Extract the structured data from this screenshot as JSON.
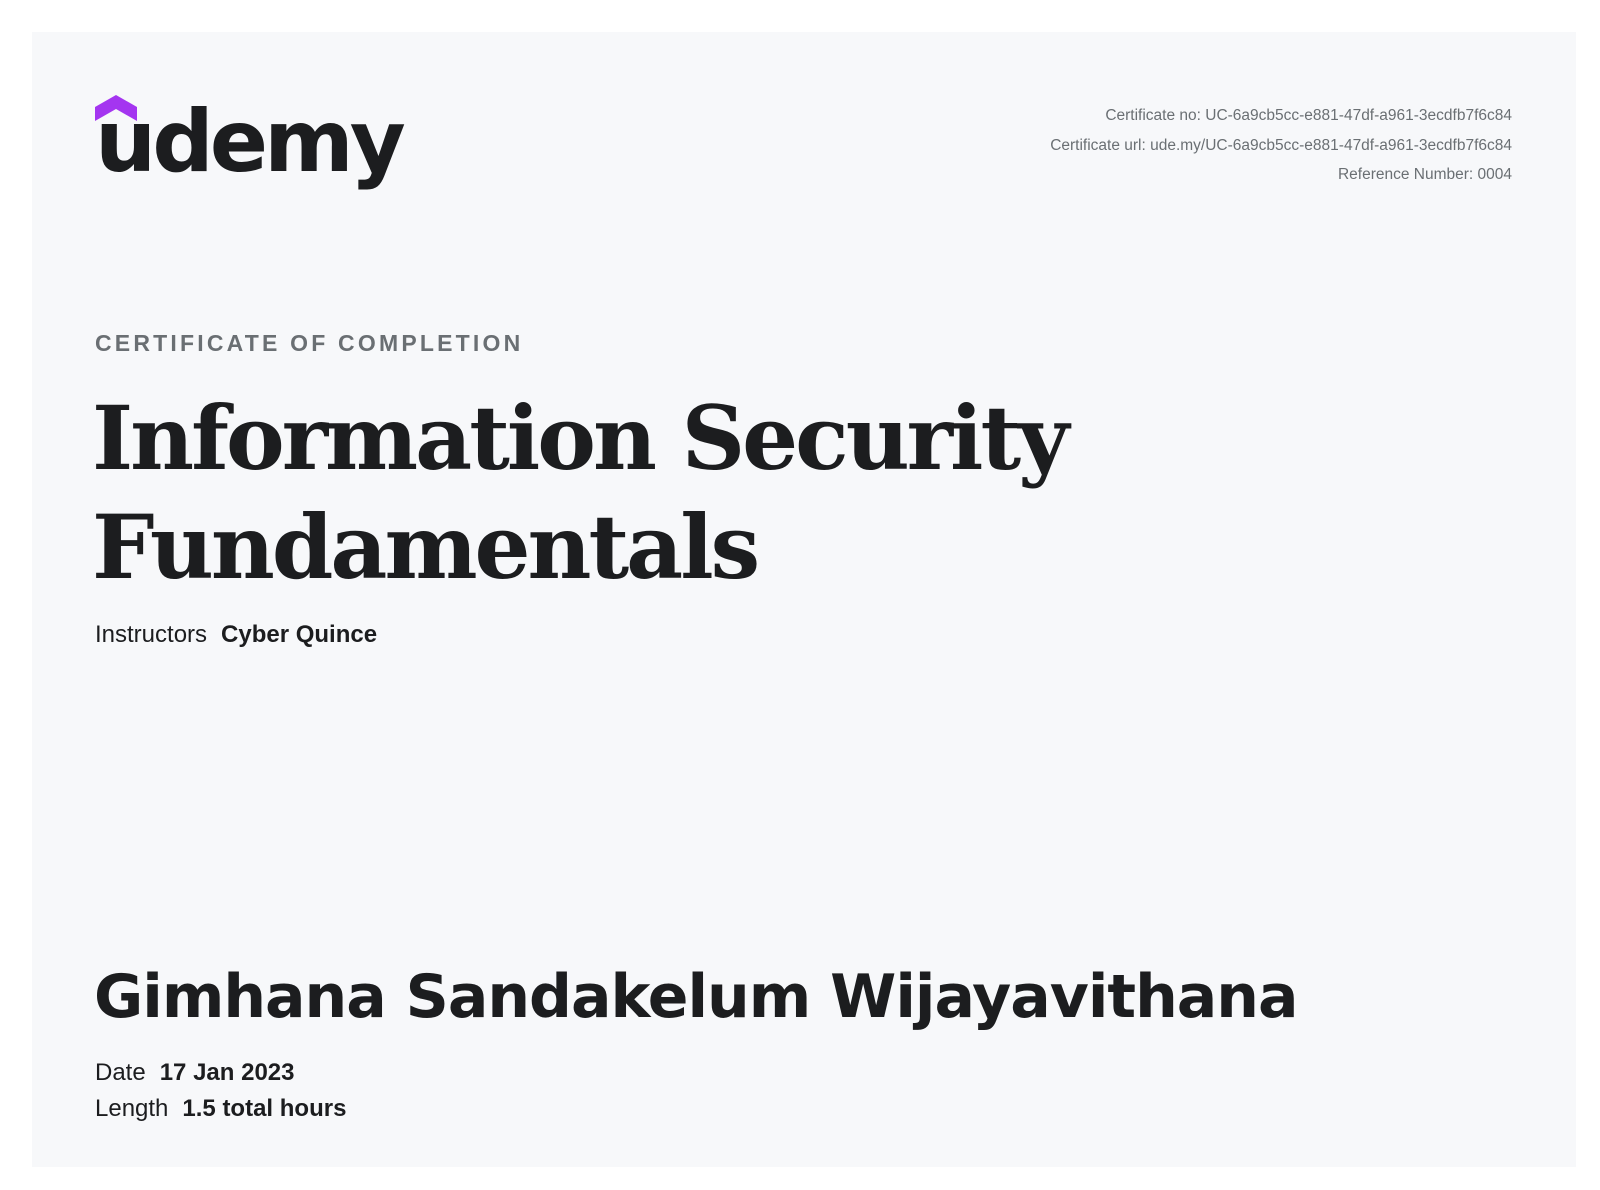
{
  "brand": {
    "logo_text": "udemy",
    "logo_icon": "graduation-cap-icon",
    "accent_color": "#a435f0",
    "text_color": "#1c1d1f"
  },
  "meta": {
    "certificate_no": "Certificate no: UC-6a9cb5cc-e881-47df-a961-3ecdfb7f6c84",
    "certificate_url": "Certificate url: ude.my/UC-6a9cb5cc-e881-47df-a961-3ecdfb7f6c84",
    "reference_number": "Reference Number: 0004"
  },
  "certificate": {
    "kicker": "CERTIFICATE OF COMPLETION",
    "course_title_line1": "Information Security",
    "course_title_line2": "Fundamentals",
    "instructors_label": "Instructors",
    "instructors_value": "Cyber Quince",
    "student_name": "Gimhana Sandakelum Wijayavithana",
    "date_label": "Date",
    "date_value": "17 Jan 2023",
    "length_label": "Length",
    "length_value": "1.5 total hours"
  }
}
